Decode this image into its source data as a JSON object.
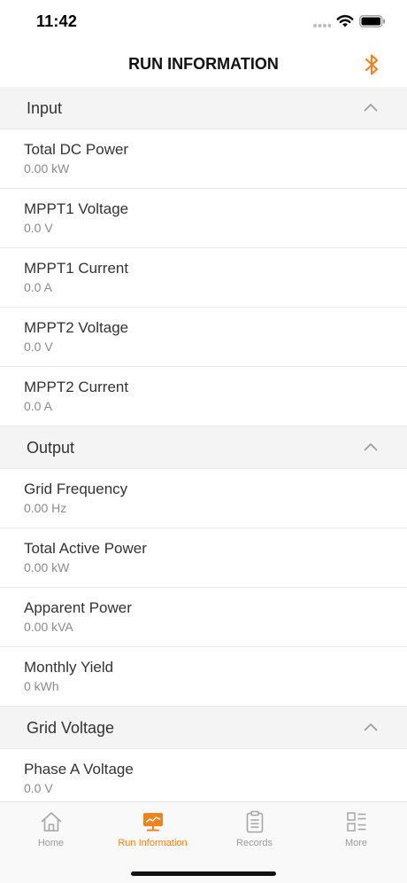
{
  "status": {
    "time": "11:42"
  },
  "nav": {
    "title": "RUN INFORMATION"
  },
  "sections": [
    {
      "title": "Input",
      "rows": [
        {
          "label": "Total DC Power",
          "value": "0.00 kW"
        },
        {
          "label": "MPPT1 Voltage",
          "value": "0.0 V"
        },
        {
          "label": "MPPT1 Current",
          "value": "0.0 A"
        },
        {
          "label": "MPPT2 Voltage",
          "value": "0.0 V"
        },
        {
          "label": "MPPT2 Current",
          "value": "0.0 A"
        }
      ]
    },
    {
      "title": "Output",
      "rows": [
        {
          "label": "Grid Frequency",
          "value": "0.00 Hz"
        },
        {
          "label": "Total Active Power",
          "value": "0.00 kW"
        },
        {
          "label": "Apparent Power",
          "value": "0.00 kVA"
        },
        {
          "label": "Monthly Yield",
          "value": "0 kWh"
        }
      ]
    },
    {
      "title": "Grid Voltage",
      "rows": [
        {
          "label": "Phase A Voltage",
          "value": "0.0 V"
        }
      ]
    }
  ],
  "tabs": [
    {
      "label": "Home",
      "icon": "home-icon",
      "active": false
    },
    {
      "label": "Run Information",
      "icon": "monitor-chart-icon",
      "active": true
    },
    {
      "label": "Records",
      "icon": "clipboard-icon",
      "active": false
    },
    {
      "label": "More",
      "icon": "grid-list-icon",
      "active": false
    }
  ],
  "colors": {
    "accent": "#f0831e",
    "section_bg": "#f4f4f4",
    "divider": "#e9e9e9",
    "muted_text": "#8a8a8a"
  }
}
